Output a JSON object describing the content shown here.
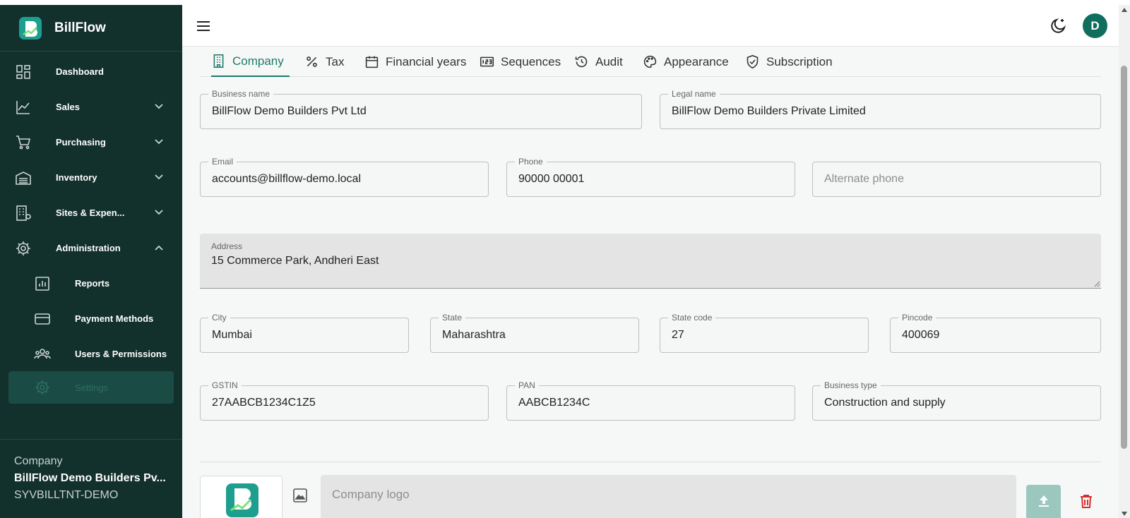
{
  "app": {
    "name": "BillFlow"
  },
  "sidebar": {
    "items": [
      {
        "label": "Dashboard",
        "icon": "dashboard-icon"
      },
      {
        "label": "Sales",
        "icon": "chart-line-icon",
        "expandable": true
      },
      {
        "label": "Purchasing",
        "icon": "cart-icon",
        "expandable": true
      },
      {
        "label": "Inventory",
        "icon": "warehouse-icon",
        "expandable": true
      },
      {
        "label": "Sites & Expen...",
        "icon": "building-icon",
        "expandable": true
      },
      {
        "label": "Administration",
        "icon": "gear-icon",
        "expanded": true
      }
    ],
    "subitems": [
      {
        "label": "Reports",
        "icon": "report-icon"
      },
      {
        "label": "Payment Methods",
        "icon": "credit-card-icon"
      },
      {
        "label": "Users & Permissions",
        "icon": "users-icon"
      },
      {
        "label": "Settings",
        "icon": "gear-icon",
        "active": true
      }
    ],
    "company": {
      "label": "Company",
      "name": "BillFlow Demo Builders Pv...",
      "code": "SYVBILLTNT-DEMO"
    }
  },
  "header": {
    "avatar_initial": "D"
  },
  "tabs": [
    {
      "label": "Company",
      "active": true,
      "icon": "building-icon"
    },
    {
      "label": "Tax",
      "icon": "percent-icon"
    },
    {
      "label": "Financial years",
      "icon": "calendar-icon"
    },
    {
      "label": "Sequences",
      "icon": "sequence-icon"
    },
    {
      "label": "Audit",
      "icon": "history-icon"
    },
    {
      "label": "Appearance",
      "icon": "palette-icon"
    },
    {
      "label": "Subscription",
      "icon": "shield-check-icon"
    }
  ],
  "form": {
    "business_name": {
      "label": "Business name",
      "value": "BillFlow Demo Builders Pvt Ltd"
    },
    "legal_name": {
      "label": "Legal name",
      "value": "BillFlow Demo Builders Private Limited"
    },
    "email": {
      "label": "Email",
      "value": "accounts@billflow-demo.local"
    },
    "phone": {
      "label": "Phone",
      "value": "90000 00001"
    },
    "alternate_phone": {
      "placeholder": "Alternate phone",
      "value": ""
    },
    "address": {
      "label": "Address",
      "value": "15 Commerce Park, Andheri East"
    },
    "city": {
      "label": "City",
      "value": "Mumbai"
    },
    "state": {
      "label": "State",
      "value": "Maharashtra"
    },
    "state_code": {
      "label": "State code",
      "value": "27"
    },
    "pincode": {
      "label": "Pincode",
      "value": "400069"
    },
    "gstin": {
      "label": "GSTIN",
      "value": "27AABCB1234C1Z5"
    },
    "pan": {
      "label": "PAN",
      "value": "AABCB1234C"
    },
    "business_type": {
      "label": "Business type",
      "value": "Construction and supply"
    },
    "company_logo": {
      "placeholder": "Company logo",
      "value": ""
    }
  },
  "colors": {
    "sidebar_bg": "#12302c",
    "accent": "#1f7a6c",
    "avatar_bg": "#0f6e5e",
    "delete": "#d32f2f",
    "upload_bg": "#9cc7bf"
  }
}
